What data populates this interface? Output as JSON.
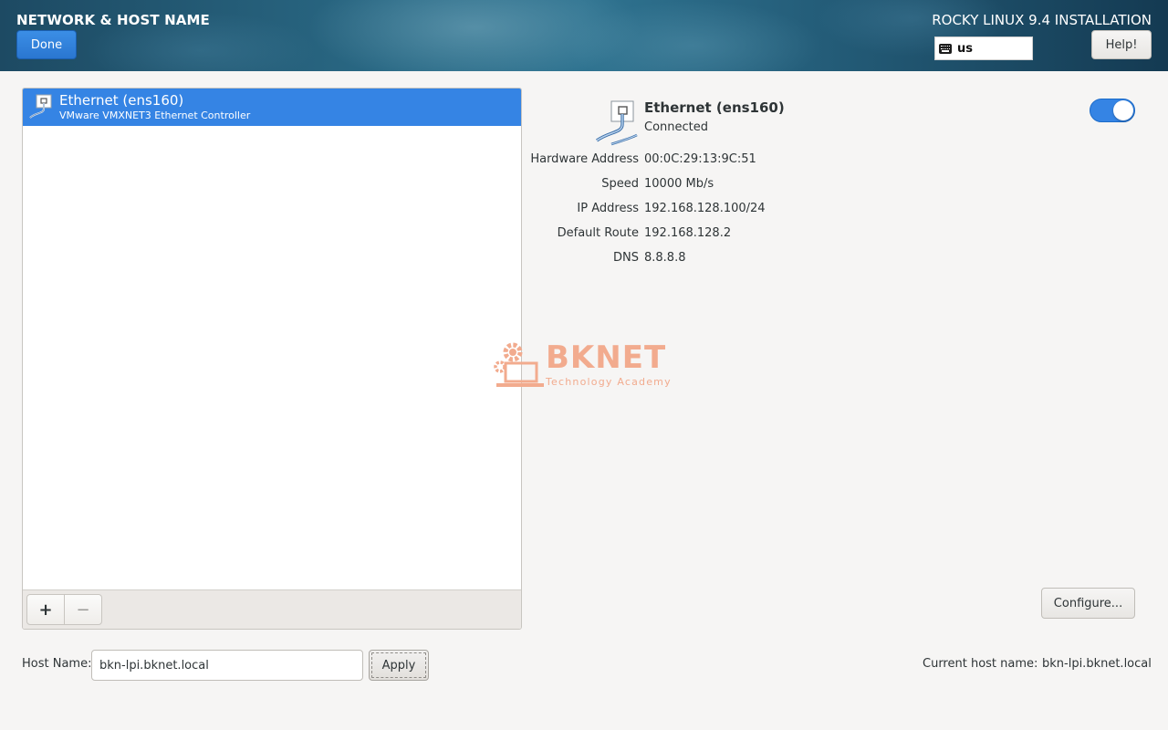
{
  "header": {
    "spoke_title": "NETWORK & HOST NAME",
    "done_label": "Done",
    "product_title": "ROCKY LINUX 9.4 INSTALLATION",
    "keyboard_layout": "us",
    "help_label": "Help!"
  },
  "devices": [
    {
      "title": "Ethernet (ens160)",
      "subtitle": "VMware VMXNET3 Ethernet Controller",
      "selected": true
    }
  ],
  "list_toolbar": {
    "add_label": "+",
    "remove_label": "−"
  },
  "details": {
    "name": "Ethernet (ens160)",
    "status": "Connected",
    "enabled": true,
    "properties": [
      {
        "label": "Hardware Address",
        "value": "00:0C:29:13:9C:51"
      },
      {
        "label": "Speed",
        "value": "10000 Mb/s"
      },
      {
        "label": "IP Address",
        "value": "192.168.128.100/24"
      },
      {
        "label": "Default Route",
        "value": "192.168.128.2"
      },
      {
        "label": "DNS",
        "value": "8.8.8.8"
      }
    ],
    "configure_label": "Configure..."
  },
  "watermark": {
    "brand": "BKNET",
    "tagline": "Technology Academy"
  },
  "hostname": {
    "label": "Host Name:",
    "value": "bkn-lpi.bknet.local",
    "apply_label": "Apply",
    "current_label": "Current host name:",
    "current_value": "bkn-lpi.bknet.local"
  },
  "colors": {
    "accent": "#3584e4",
    "watermark": "#f2ab8e"
  }
}
